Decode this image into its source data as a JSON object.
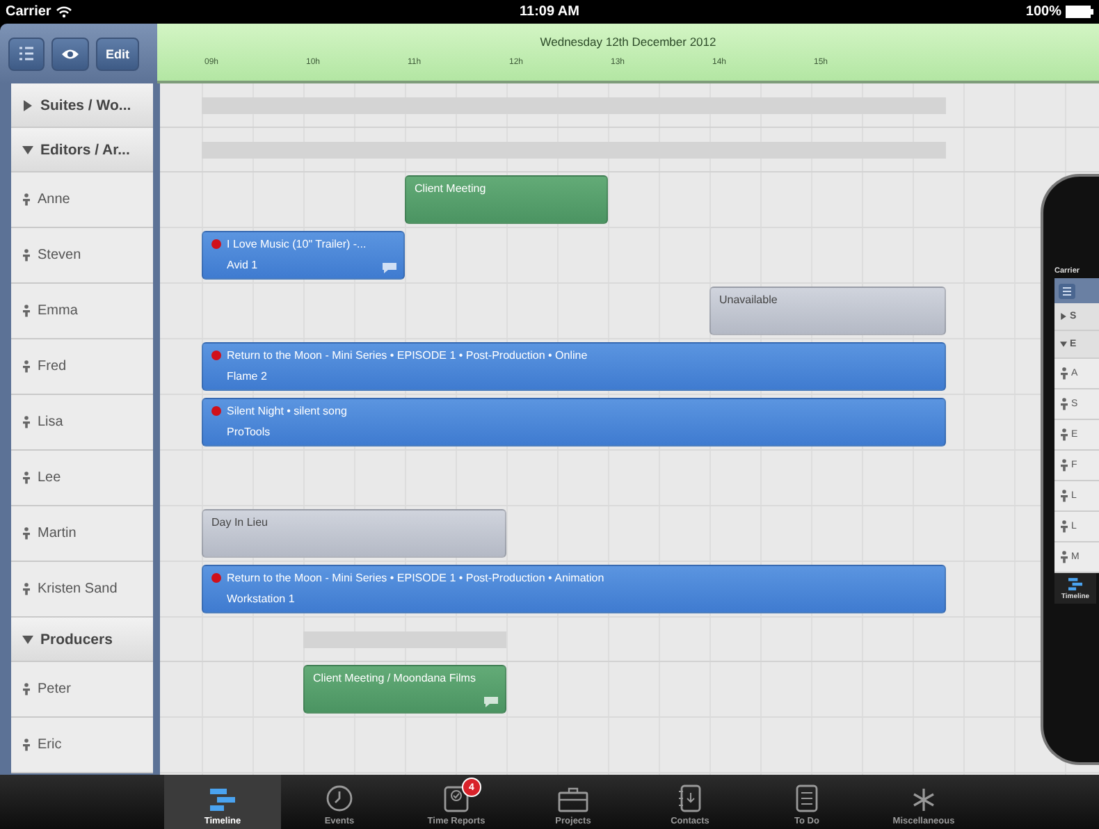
{
  "status_bar": {
    "carrier": "Carrier",
    "time": "11:09 AM",
    "battery": "100%"
  },
  "toolbar": {
    "edit_label": "Edit"
  },
  "header": {
    "date": "Wednesday 12th December 2012",
    "hours": [
      "09h",
      "10h",
      "11h",
      "12h",
      "13h",
      "14h",
      "15h"
    ]
  },
  "groups": [
    {
      "label": "Suites / Wo...",
      "expanded": false
    },
    {
      "label": "Editors / Ar...",
      "expanded": true,
      "children": [
        {
          "name": "Anne",
          "events": [
            {
              "kind": "meeting",
              "title": "Client Meeting",
              "alert": false,
              "comment": false
            }
          ]
        },
        {
          "name": "Steven",
          "events": [
            {
              "kind": "booking",
              "title": "I Love Music (10\" Trailer) -...",
              "subtitle": "Avid 1",
              "alert": true,
              "comment": true
            }
          ]
        },
        {
          "name": "Emma",
          "events": [
            {
              "kind": "absence",
              "title": "Unavailable",
              "alert": false,
              "comment": false
            }
          ]
        },
        {
          "name": "Fred",
          "events": [
            {
              "kind": "booking",
              "title": "Return to the Moon - Mini Series • EPISODE 1 • Post-Production • Online",
              "subtitle": "Flame 2",
              "alert": true,
              "comment": false
            }
          ]
        },
        {
          "name": "Lisa",
          "events": [
            {
              "kind": "booking",
              "title": "Silent Night • silent song",
              "subtitle": "ProTools",
              "alert": true,
              "comment": false
            }
          ]
        },
        {
          "name": "Lee"
        },
        {
          "name": "Martin",
          "events": [
            {
              "kind": "absence",
              "title": "Day In Lieu",
              "alert": false,
              "comment": false
            }
          ]
        },
        {
          "name": "Kristen Sand",
          "events": [
            {
              "kind": "booking",
              "title": "Return to the Moon - Mini Series • EPISODE 1 • Post-Production • Animation",
              "subtitle": "Workstation 1",
              "alert": true,
              "comment": false
            }
          ]
        }
      ]
    },
    {
      "label": "Producers",
      "expanded": true,
      "children": [
        {
          "name": "Peter",
          "events": [
            {
              "kind": "meeting",
              "title": "Client Meeting / Moondana Films",
              "alert": false,
              "comment": true
            }
          ]
        },
        {
          "name": "Eric"
        }
      ]
    }
  ],
  "tabs": [
    {
      "label": "Timeline",
      "selected": true
    },
    {
      "label": "Events",
      "selected": false
    },
    {
      "label": "Time Reports",
      "selected": false,
      "badge": "4"
    },
    {
      "label": "Projects",
      "selected": false
    },
    {
      "label": "Contacts",
      "selected": false
    },
    {
      "label": "To Do",
      "selected": false
    },
    {
      "label": "Miscellaneous",
      "selected": false
    }
  ],
  "phone": {
    "carrier": "Carrier",
    "rows": [
      {
        "kind": "group",
        "label": "S",
        "expanded": false
      },
      {
        "kind": "group",
        "label": "E",
        "expanded": true
      },
      {
        "kind": "person",
        "label": "A"
      },
      {
        "kind": "person",
        "label": "S"
      },
      {
        "kind": "person",
        "label": "E"
      },
      {
        "kind": "person",
        "label": "F"
      },
      {
        "kind": "person",
        "label": "L"
      },
      {
        "kind": "person",
        "label": "L"
      },
      {
        "kind": "person",
        "label": "M"
      }
    ],
    "tab": "Timeline"
  }
}
